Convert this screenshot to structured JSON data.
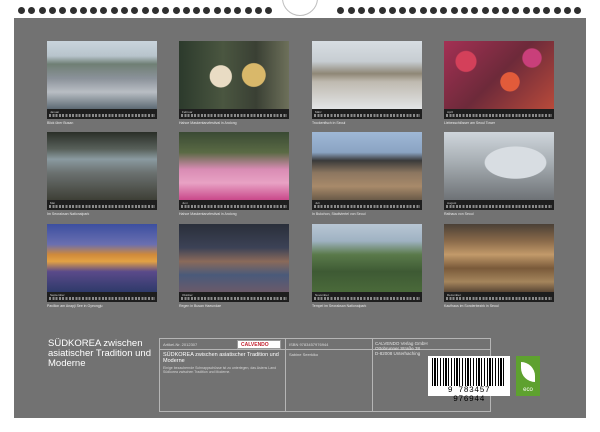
{
  "cover": {
    "title": "SÜDKOREA zwischen asiatischer Tradition und Moderne"
  },
  "tiles": [
    {
      "caption": "Blick über Busan",
      "month": "Januar"
    },
    {
      "caption": "Hahoe Maskentanzfestival in Andong",
      "month": "Februar"
    },
    {
      "caption": "Trockenfisch in Seoul",
      "month": "März"
    },
    {
      "caption": "Liebesschlösser am Seoul Tower",
      "month": "April"
    },
    {
      "caption": "Im Seoraksan Nationalpark",
      "month": "Mai"
    },
    {
      "caption": "Hahoe Maskentanzfestival in Andong",
      "month": "Juni"
    },
    {
      "caption": "In Bukchon, Stadtviertel von Seoul",
      "month": "Juli"
    },
    {
      "caption": "Rathaus von Seoul",
      "month": "August"
    },
    {
      "caption": "Pavillon am Anapji See in Gyeongju",
      "month": "September"
    },
    {
      "caption": "Regen in Busan Haeundae",
      "month": "Oktober"
    },
    {
      "caption": "Tempel im Seoraksan Nationalpark",
      "month": "November"
    },
    {
      "caption": "Kaufhaus im Sonderbezirk in Seoul",
      "month": "Dezember"
    }
  ],
  "info": {
    "article": "Artikel-Nr. 2012307",
    "logo": "CALVENDO",
    "isbn": "ISBN 9783457976944",
    "title": "SÜDKOREA zwischen asiatischer Tradition und Moderne",
    "description": "Einige bezaubernde Schnappschüsse ist zu unterlegen, das Asiens Land Südkorea zwischen Tradition und Moderne.",
    "author": "Sabine Seerkiko",
    "publisher": "CALVENDO Verlag GmbH\nOttobrunner Straße 38\nD-82008 Unterhaching"
  },
  "barcode": {
    "number": "9 783457 976944"
  },
  "eco": {
    "label": "eco"
  }
}
